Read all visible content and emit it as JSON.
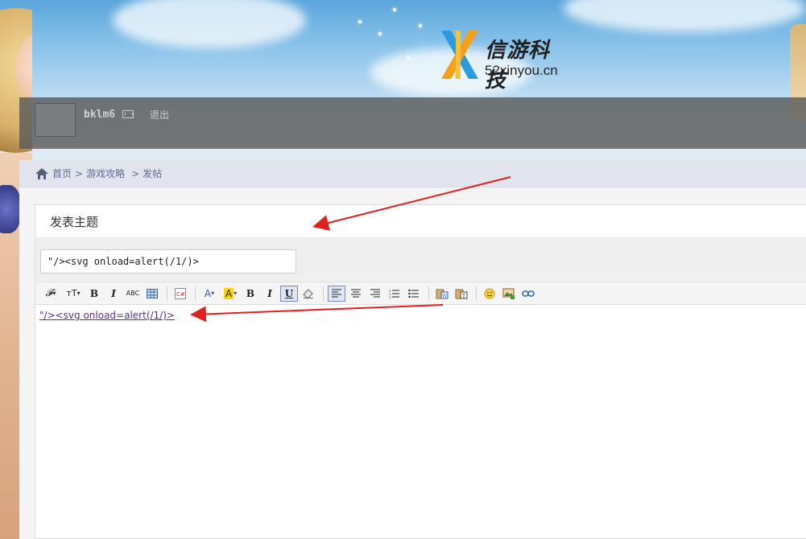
{
  "logo": {
    "chinese": "信游科技",
    "english": "52xinyou.cn"
  },
  "userbar": {
    "username": "bklm6",
    "logout": "退出"
  },
  "breadcrumb": {
    "home": "首页",
    "sep1": ">",
    "category": "游戏攻略",
    "sep2": ">",
    "current": "发帖"
  },
  "post": {
    "title": "发表主题",
    "subject_value": "\"/><svg onload=alert(/1/)>",
    "editor_content": "\"/><svg onload=alert(/1/)>"
  },
  "toolbar": {
    "bold": "B",
    "italic": "I",
    "bold2": "B",
    "italic2": "I",
    "underline": "U",
    "font_color_label": "A",
    "bg_color_label": "A",
    "strike": "ABC"
  },
  "colors": {
    "annotation_arrow": "#e02020",
    "userbar_bg": "#5a5a5a",
    "breadcrumb_bg": "#e3e5ee",
    "link": "#5b2c8a"
  }
}
